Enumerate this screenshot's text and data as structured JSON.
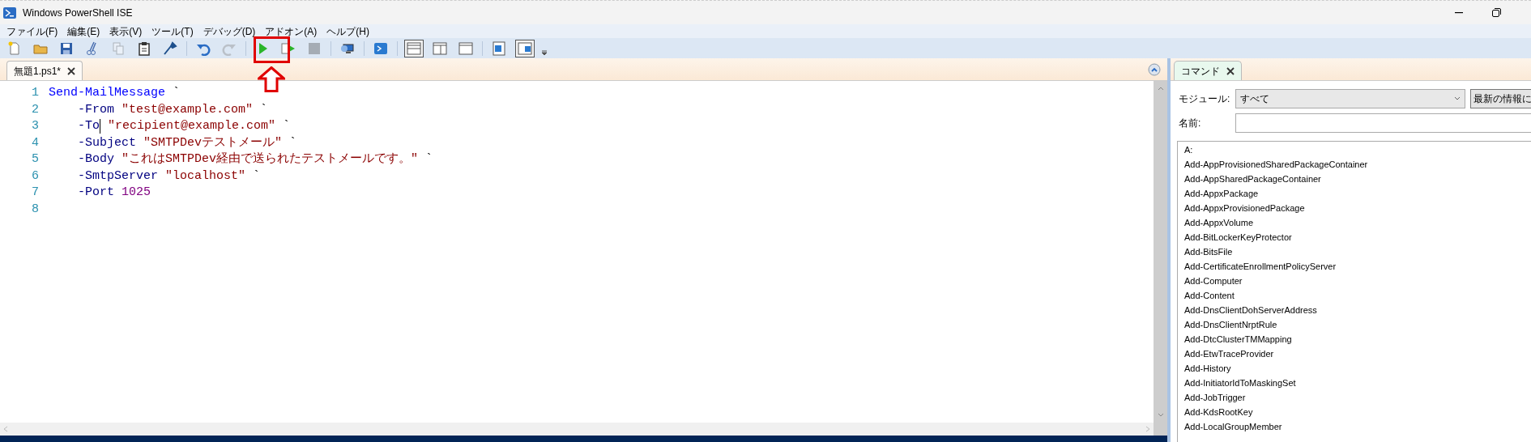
{
  "window": {
    "title": "Windows PowerShell ISE"
  },
  "menu": [
    "ファイル(F)",
    "編集(E)",
    "表示(V)",
    "ツール(T)",
    "デバッグ(D)",
    "アドオン(A)",
    "ヘルプ(H)"
  ],
  "toolbar": [
    {
      "kind": "new",
      "disabled": false
    },
    {
      "kind": "open",
      "disabled": false
    },
    {
      "kind": "save",
      "disabled": false
    },
    {
      "kind": "cut",
      "disabled": false
    },
    {
      "kind": "copy",
      "disabled": true
    },
    {
      "kind": "paste",
      "disabled": false
    },
    {
      "kind": "clear",
      "disabled": false
    },
    {
      "kind": "sep"
    },
    {
      "kind": "undo",
      "disabled": false
    },
    {
      "kind": "redo",
      "disabled": true
    },
    {
      "kind": "sep"
    },
    {
      "kind": "run",
      "disabled": false
    },
    {
      "kind": "run-selection",
      "disabled": false
    },
    {
      "kind": "stop",
      "disabled": true
    },
    {
      "kind": "sep"
    },
    {
      "kind": "remote",
      "disabled": false
    },
    {
      "kind": "sep"
    },
    {
      "kind": "console",
      "disabled": false
    },
    {
      "kind": "sep"
    },
    {
      "kind": "layout-top",
      "selected": true
    },
    {
      "kind": "layout-right",
      "selected": false
    },
    {
      "kind": "layout-max",
      "selected": false
    },
    {
      "kind": "sep"
    },
    {
      "kind": "show-commands",
      "selected": false
    },
    {
      "kind": "show-addon",
      "selected": true
    }
  ],
  "editor_tabs": [
    {
      "label": "無題1.ps1*",
      "selected": true
    }
  ],
  "code_lines": [
    {
      "number": "1",
      "indent": false,
      "tokens": [
        {
          "kind": "command",
          "text": "Send-MailMessage"
        },
        {
          "kind": "plain",
          "text": "`"
        }
      ]
    },
    {
      "number": "2",
      "indent": true,
      "tokens": [
        {
          "kind": "parameter",
          "text": "-From"
        },
        {
          "kind": "string",
          "text": "\"test@example.com\""
        },
        {
          "kind": "plain",
          "text": "`"
        }
      ]
    },
    {
      "number": "3",
      "indent": true,
      "tokens": [
        {
          "kind": "parameter",
          "text": "-To",
          "caret": true
        },
        {
          "kind": "string",
          "text": "\"recipient@example.com\""
        },
        {
          "kind": "plain",
          "text": "`"
        }
      ]
    },
    {
      "number": "4",
      "indent": true,
      "tokens": [
        {
          "kind": "parameter",
          "text": "-Subject"
        },
        {
          "kind": "string",
          "text": "\"SMTPDevテストメール\""
        },
        {
          "kind": "plain",
          "text": "`"
        }
      ]
    },
    {
      "number": "5",
      "indent": true,
      "tokens": [
        {
          "kind": "parameter",
          "text": "-Body"
        },
        {
          "kind": "string",
          "text": "\"これはSMTPDev経由で送られたテストメールです。\""
        },
        {
          "kind": "plain",
          "text": "`"
        }
      ]
    },
    {
      "number": "6",
      "indent": true,
      "tokens": [
        {
          "kind": "parameter",
          "text": "-SmtpServer"
        },
        {
          "kind": "string",
          "text": "\"localhost\""
        },
        {
          "kind": "plain",
          "text": "`"
        }
      ]
    },
    {
      "number": "7",
      "indent": true,
      "tokens": [
        {
          "kind": "parameter",
          "text": "-Port"
        },
        {
          "kind": "number",
          "text": "1025"
        }
      ]
    },
    {
      "number": "8"
    }
  ],
  "command_panel": {
    "tab": {
      "label": "コマンド",
      "selected": true
    },
    "module_label": "モジュール:",
    "module_value": "すべて",
    "refresh_button": "最新の情報に",
    "name_label": "名前:",
    "commands": [
      "A:",
      "Add-AppProvisionedSharedPackageContainer",
      "Add-AppSharedPackageContainer",
      "Add-AppxPackage",
      "Add-AppxProvisionedPackage",
      "Add-AppxVolume",
      "Add-BitLockerKeyProtector",
      "Add-BitsFile",
      "Add-CertificateEnrollmentPolicyServer",
      "Add-Computer",
      "Add-Content",
      "Add-DnsClientDohServerAddress",
      "Add-DnsClientNrptRule",
      "Add-DtcClusterTMMapping",
      "Add-EtwTraceProvider",
      "Add-History",
      "Add-InitiatorIdToMaskingSet",
      "Add-JobTrigger",
      "Add-KdsRootKey",
      "Add-LocalGroupMember"
    ]
  }
}
